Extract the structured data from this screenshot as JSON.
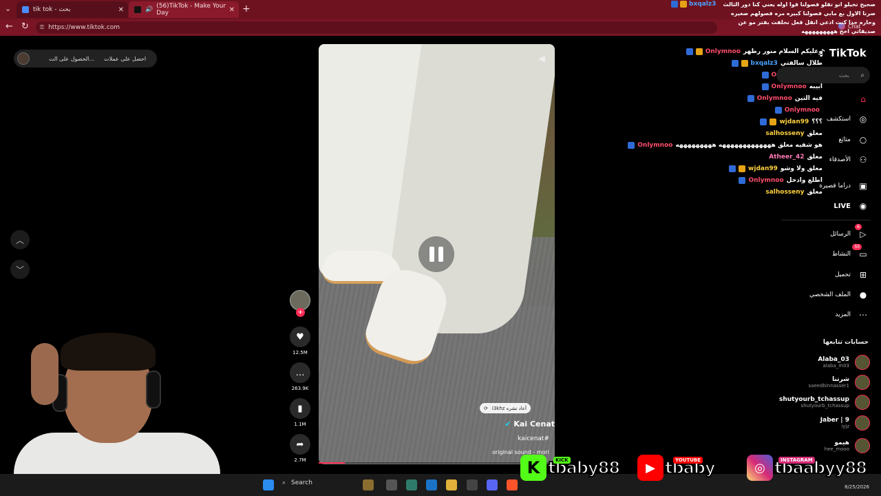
{
  "browser": {
    "tabs": [
      {
        "title": "tik tok - بحث",
        "active": false
      },
      {
        "title": "(56)TikTok - Make Your Day",
        "active": true
      }
    ],
    "url": "https://www.tiktok.com",
    "chat_label": "Chat"
  },
  "overlay_left": {
    "coins_label": "احصل على عملات",
    "get_label": "الحصول على الت..."
  },
  "video": {
    "repost_text": "i3khz أعاد نشره",
    "author": "Kai Cenat",
    "hashtag": "kaicenat#",
    "sound": "original sound - mori",
    "progress_percent": 11
  },
  "actions": {
    "likes": "12.5M",
    "comments": "263.9K",
    "saves": "1.1M",
    "shares": "2.7M"
  },
  "live_chat": {
    "top_user": "bxqalz3",
    "top_message": "صحيح تخيلو انو تقلو فصولنا قوا اوله يعني كنا دور الثالث صرنا الاول بع مابي فصولنا كبيره مره فصولهم صغيره وحاره جدا كنت ادعي انقل قعل نحلفت بفتر مو عن صديقاتي اخخ هههههههههه",
    "messages": [
      {
        "user": "Onlymnoo",
        "text": "وعليكم السلام منور رظهر",
        "color": "#ff4d6d",
        "badges": 2
      },
      {
        "user": "bxqalz3",
        "text": "طلال سالفتي",
        "color": "#4aa3ff",
        "badges": 2
      },
      {
        "user": "Onlymnoo",
        "text": "ابيبه",
        "color": "#ff4d6d",
        "badges": 1
      },
      {
        "user": "Onlymnoo",
        "text": "ابيبه",
        "color": "#ff4d6d",
        "badges": 1
      },
      {
        "user": "Onlymnoo",
        "text": "فيه التين",
        "color": "#ff4d6d",
        "badges": 1
      },
      {
        "user": "Onlymnoo",
        "text": "",
        "color": "#ff4d6d",
        "badges": 1
      },
      {
        "user": "wjdan99",
        "text": "؟؟؟",
        "color": "#ffd23f",
        "badges": 2
      },
      {
        "user": "salhosseny",
        "text": "معلق",
        "color": "#ffd23f",
        "badges": 0
      },
      {
        "user": "Onlymnoo",
        "text": "هو شفيه معلق هههههههههههههه هههههههههه",
        "color": "#ff4d6d",
        "badges": 1
      },
      {
        "user": "Atheer_42",
        "text": "معلق",
        "color": "#ff7ab8",
        "badges": 0
      },
      {
        "user": "wjdan99",
        "text": "معلق ولا وشو",
        "color": "#ffd23f",
        "badges": 2
      },
      {
        "user": "Onlymnoo",
        "text": "اطلع وادخل",
        "color": "#ff4d6d",
        "badges": 1
      },
      {
        "user": "salhosseny",
        "text": "معلق",
        "color": "#ffd23f",
        "badges": 0
      }
    ]
  },
  "tiktok_sidebar": {
    "logo": "TikTok",
    "search_placeholder": "بحث",
    "nav": [
      {
        "label": "",
        "icon": "home-icon",
        "glyph": "⌂",
        "badge": ""
      },
      {
        "label": "استكشف",
        "icon": "compass-icon",
        "glyph": "◎",
        "badge": ""
      },
      {
        "label": "متابَع",
        "icon": "avatar-icon",
        "glyph": "○",
        "badge": ""
      },
      {
        "label": "الأصدقاء",
        "icon": "friends-icon",
        "glyph": "⚇",
        "badge": ""
      },
      {
        "label": "دراما قصيرة",
        "icon": "drama-icon",
        "glyph": "▣",
        "badge": ""
      },
      {
        "label": "LIVE",
        "icon": "live-icon",
        "glyph": "◉",
        "badge": ""
      },
      {
        "label": "الرسائل",
        "icon": "messages-icon",
        "glyph": "▷",
        "badge": "6"
      },
      {
        "label": "النشاط",
        "icon": "activity-icon",
        "glyph": "▭",
        "badge": "50"
      },
      {
        "label": "تحميل",
        "icon": "upload-icon",
        "glyph": "⊞",
        "badge": ""
      },
      {
        "label": "الملف الشخصي",
        "icon": "profile-icon",
        "glyph": "●",
        "badge": ""
      },
      {
        "label": "المزيد",
        "icon": "more-icon",
        "glyph": "⋯",
        "badge": ""
      }
    ],
    "following_title": "حسابات تتابعها",
    "following": [
      {
        "name": "Alaba_03",
        "handle": "alaba_m03"
      },
      {
        "name": "شرتنا",
        "handle": "saeedbinnasser1"
      },
      {
        "name": "shutyourb_tchassup",
        "handle": "shutyourb_tchassup"
      },
      {
        "name": "Jaber | 9",
        "handle": "iyjz"
      },
      {
        "name": "هيمو",
        "handle": "hee_mooo"
      }
    ]
  },
  "taskbar": {
    "search_label": "Search",
    "date": "8/25/2026"
  },
  "socials": [
    {
      "platform": "KICK",
      "handle": "tbaby88",
      "color": "#53fc18"
    },
    {
      "platform": "YOUTUBE",
      "handle": "tbaby",
      "color": "#ff0000"
    },
    {
      "platform": "INSTAGRAM",
      "handle": "tbaabyy88",
      "color": "#d62976"
    }
  ],
  "colors": {
    "tiktok_red": "#fe2c55",
    "browser_frame": "#6e1220"
  }
}
